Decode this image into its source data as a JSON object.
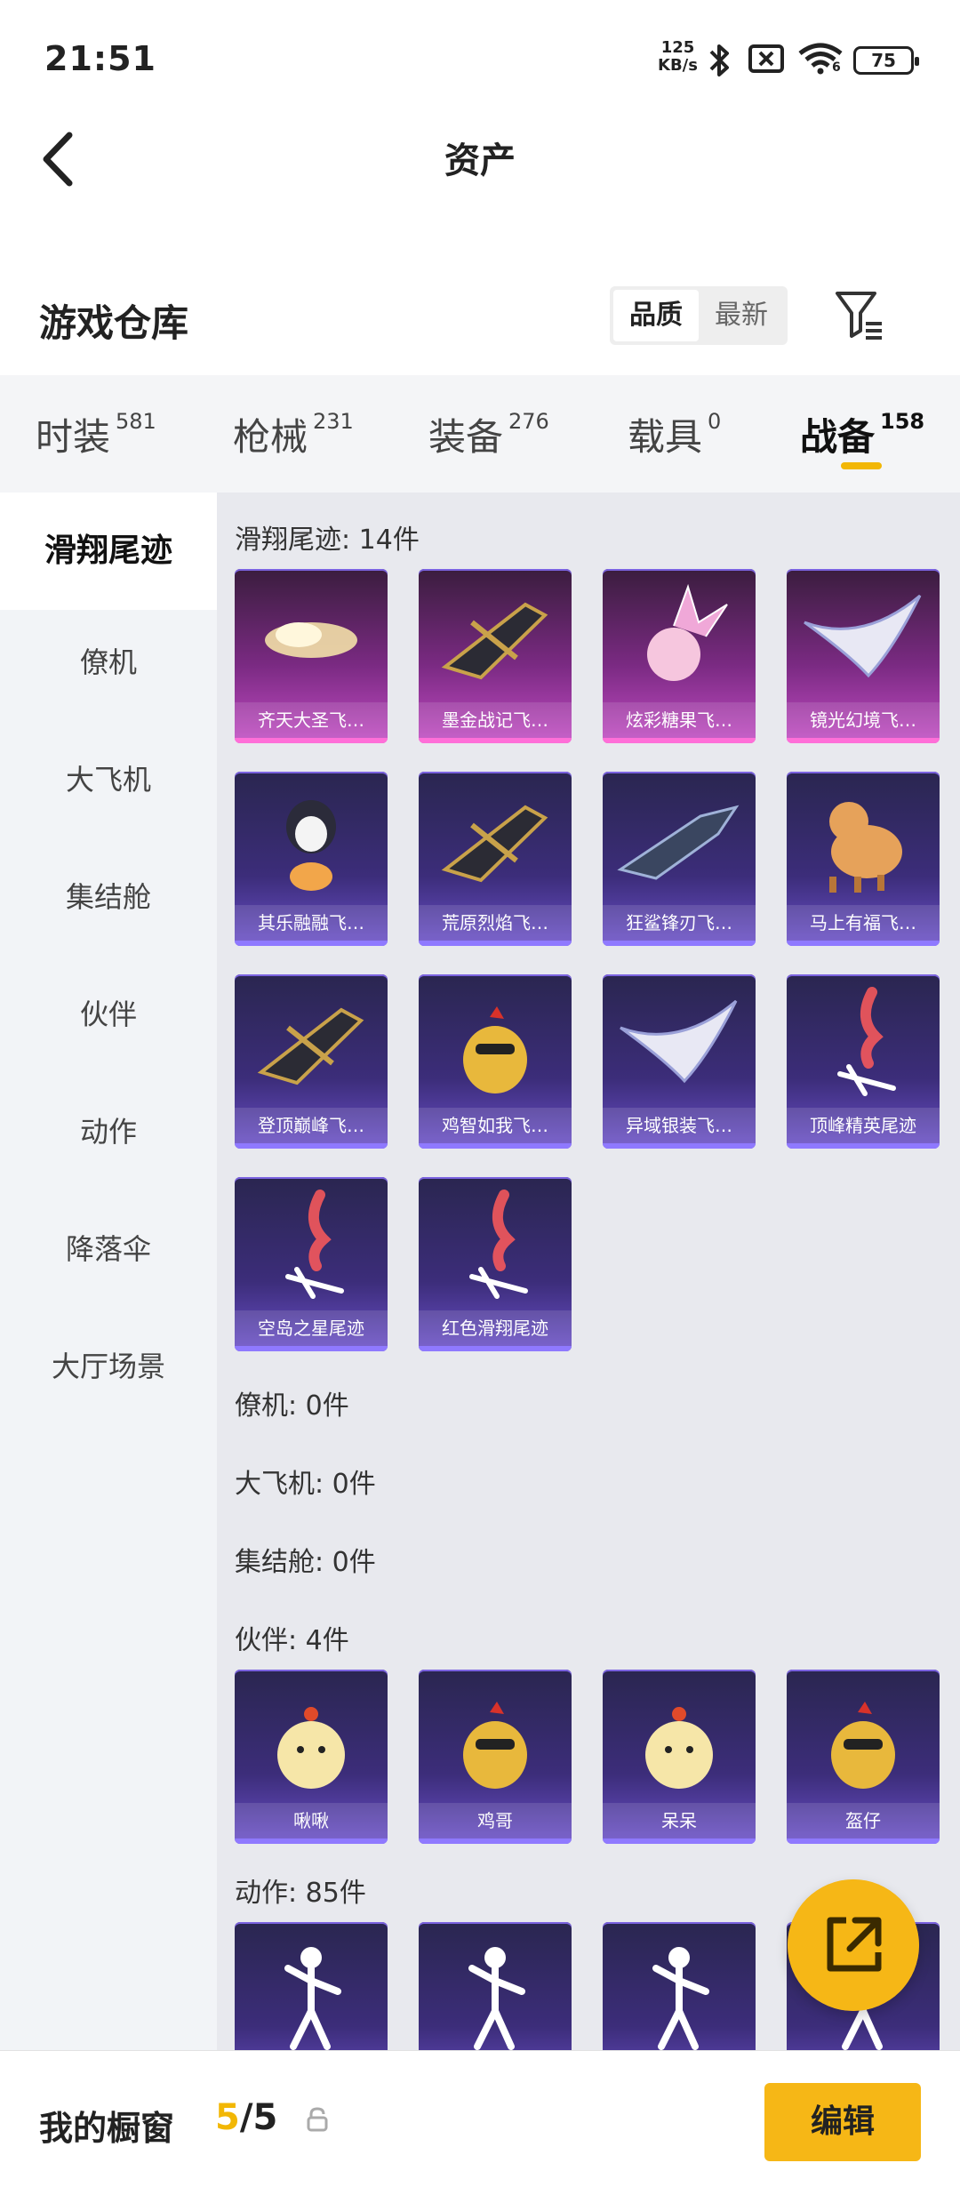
{
  "status_bar": {
    "time": "21:51",
    "net_speed_value": "125",
    "net_speed_unit": "KB/s",
    "wifi_label": "6",
    "battery": "75"
  },
  "header": {
    "title": "资产"
  },
  "warehouse": {
    "title": "游戏仓库",
    "sort_options": [
      "品质",
      "最新"
    ],
    "active_sort": "品质"
  },
  "tabs": [
    {
      "label": "时装",
      "count": "581"
    },
    {
      "label": "枪械",
      "count": "231"
    },
    {
      "label": "装备",
      "count": "276"
    },
    {
      "label": "载具",
      "count": "0"
    },
    {
      "label": "战备",
      "count": "158"
    }
  ],
  "active_tab": "战备",
  "sidebar": {
    "items": [
      "滑翔尾迹",
      "僚机",
      "大飞机",
      "集结舱",
      "伙伴",
      "动作",
      "降落伞",
      "大厅场景"
    ],
    "active": "滑翔尾迹"
  },
  "sections": [
    {
      "label": "滑翔尾迹: 14件",
      "items": [
        {
          "name": "齐天大圣飞…",
          "icon": "cloud-icon",
          "style": "pink"
        },
        {
          "name": "墨金战记飞…",
          "icon": "jet-icon",
          "style": "pink"
        },
        {
          "name": "炫彩糖果飞…",
          "icon": "candy-icon",
          "style": "pink"
        },
        {
          "name": "镜光幻境飞…",
          "icon": "wing-icon",
          "style": "pink"
        },
        {
          "name": "其乐融融飞…",
          "icon": "penguin-icon",
          "style": "purple"
        },
        {
          "name": "荒原烈焰飞…",
          "icon": "jet-icon",
          "style": "purple"
        },
        {
          "name": "狂鲨锋刃飞…",
          "icon": "shark-icon",
          "style": "purple"
        },
        {
          "name": "马上有福飞…",
          "icon": "horse-icon",
          "style": "purple"
        },
        {
          "name": "登顶巅峰飞…",
          "icon": "jet-icon",
          "style": "purple"
        },
        {
          "name": "鸡智如我飞…",
          "icon": "chicken-icon",
          "style": "purple"
        },
        {
          "name": "异域银装飞…",
          "icon": "wing-icon",
          "style": "purple"
        },
        {
          "name": "顶峰精英尾迹",
          "icon": "smoke-trail-icon",
          "style": "purple"
        },
        {
          "name": "空岛之星尾迹",
          "icon": "smoke-trail-icon",
          "style": "purple"
        },
        {
          "name": "红色滑翔尾迹",
          "icon": "smoke-trail-icon",
          "style": "purple"
        }
      ]
    },
    {
      "label": "僚机: 0件",
      "items": []
    },
    {
      "label": "大飞机: 0件",
      "items": []
    },
    {
      "label": "集结舱: 0件",
      "items": []
    },
    {
      "label": "伙伴: 4件",
      "items": [
        {
          "name": "啾啾",
          "icon": "chick-icon",
          "style": "purple"
        },
        {
          "name": "鸡哥",
          "icon": "chicken-icon",
          "style": "purple"
        },
        {
          "name": "呆呆",
          "icon": "chick-icon",
          "style": "purple"
        },
        {
          "name": "盔仔",
          "icon": "chicken-icon",
          "style": "purple"
        }
      ]
    },
    {
      "label": "动作: 85件",
      "items": [
        {
          "name": "",
          "icon": "dance-icon",
          "style": "purple"
        },
        {
          "name": "",
          "icon": "dance-icon",
          "style": "purple"
        },
        {
          "name": "",
          "icon": "dance-icon",
          "style": "purple"
        },
        {
          "name": "",
          "icon": "dance-icon",
          "style": "purple"
        }
      ]
    }
  ],
  "showcase": {
    "title": "我的橱窗",
    "current": "5",
    "total": "/5",
    "edit_label": "编辑"
  },
  "colors": {
    "accent": "#f6b716",
    "card_purple": "#3c2d7a",
    "card_pink": "#7a2a82"
  }
}
